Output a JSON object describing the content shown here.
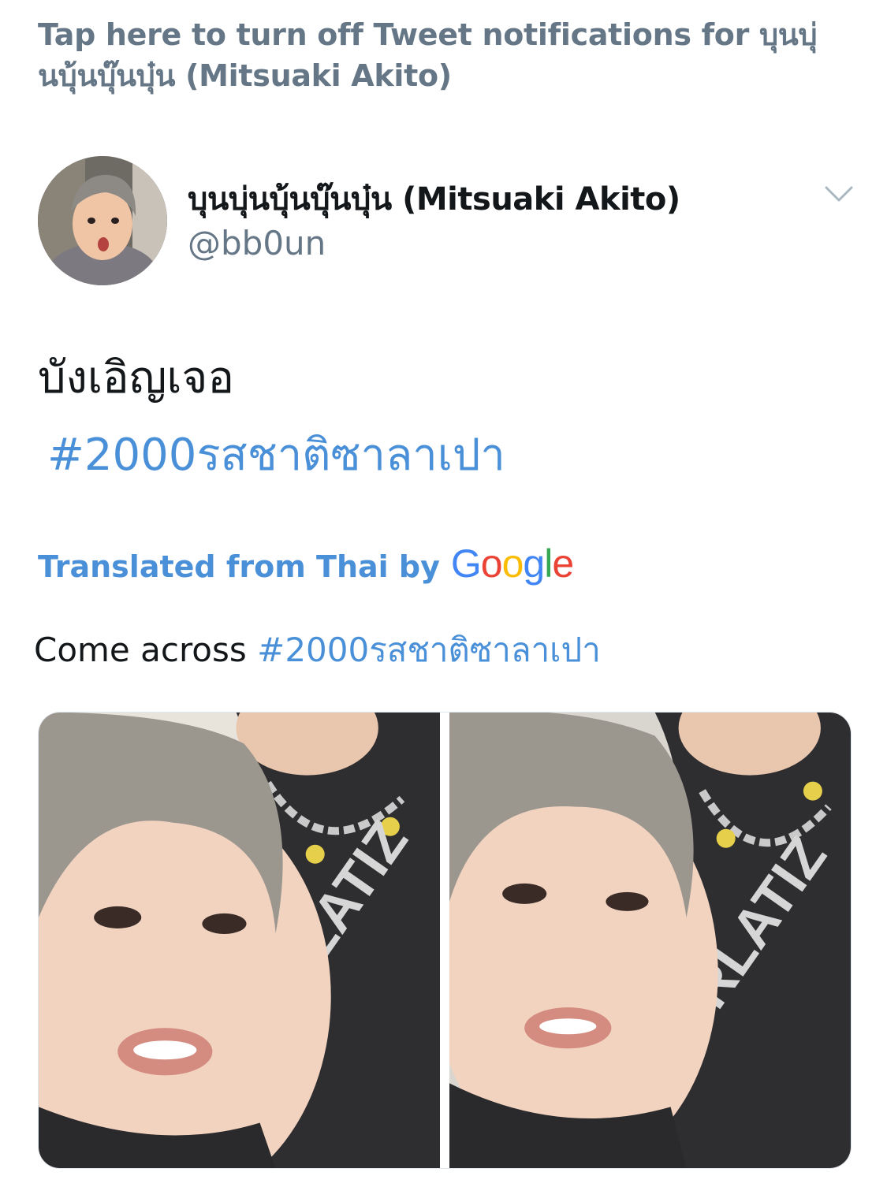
{
  "notification": {
    "text": "Tap here to turn off Tweet notifications for บุนบุ่นบุ้นบุ๊นบุ๋น (Mitsuaki Akito)"
  },
  "author": {
    "display_name": "บุนบุ่นบุ้นบุ๊นบุ๋น (Mitsuaki Akito)",
    "handle": "@bb0un",
    "avatar_icon": "user-avatar"
  },
  "tweet": {
    "text": "บังเอิญเจอ",
    "hashtag": "#2000รสชาติซาลาเปา"
  },
  "translation": {
    "label": "Translated from Thai by",
    "provider": "Google",
    "text": "Come across",
    "hashtag": "#2000รสชาติซาลาเปา"
  },
  "colors": {
    "link": "#4a90d9",
    "muted": "#657786",
    "text": "#14171a",
    "google_blue": "#4285F4",
    "google_red": "#EA4335",
    "google_yellow": "#FBBC05",
    "google_green": "#34A853"
  },
  "media": {
    "photos": [
      "photo-1",
      "photo-2"
    ]
  }
}
